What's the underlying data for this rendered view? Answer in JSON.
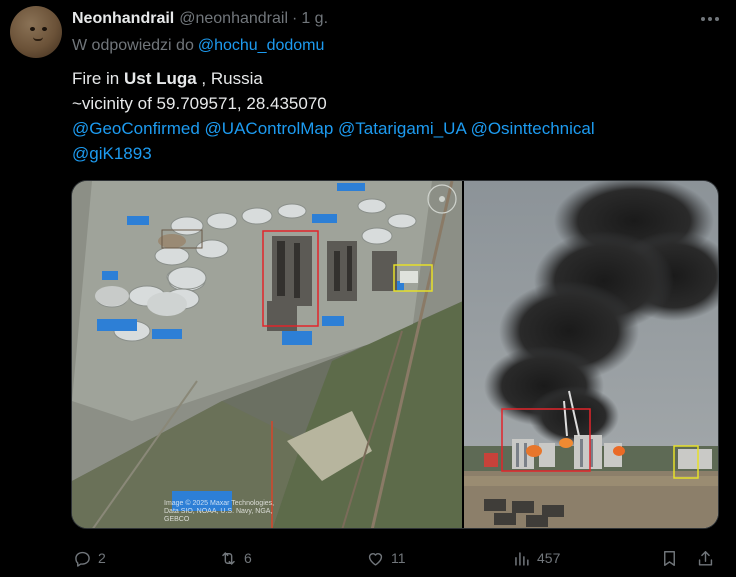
{
  "tweet": {
    "author": {
      "name": "Neonhandrail",
      "handle": "@neonhandrail",
      "separator": "·",
      "time": "1 g."
    },
    "reply_prefix": "W odpowiedzi do",
    "reply_to": "@hochu_dodomu",
    "text": {
      "line1_pre": "Fire in ",
      "line1_bold": "Ust Luga",
      "line1_post": " , Russia",
      "line2": "~vicinity of 59.709571, 28.435070",
      "mentions": [
        "@GeoConfirmed",
        "@UAControlMap",
        "@Tatarigami_UA",
        "@Osinttechnical",
        "@giK1893"
      ]
    },
    "media": {
      "satellite_watermark": "Image © 2025 Maxar Technologies, Data SIO, NOAA, U.S. Navy, NGA, GEBCO"
    },
    "actions": {
      "replies": "2",
      "retweets": "6",
      "likes": "11",
      "views": "457"
    },
    "colors": {
      "background": "#000000",
      "text": "#e7e9ea",
      "secondary": "#71767b",
      "link": "#1d9bf0"
    }
  }
}
